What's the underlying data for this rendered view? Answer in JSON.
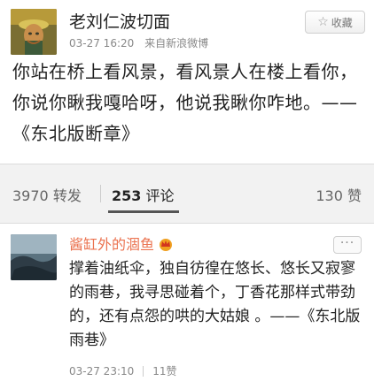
{
  "post": {
    "username": "老刘仁波切面",
    "time": "03-27 16:20",
    "source": "来自新浪微博",
    "favorite_label": "收藏",
    "text": "你站在桥上看风景，看风景人在楼上看你，你说你瞅我嘎哈呀，他说我瞅你咋地。——《东北版断章》"
  },
  "stats": {
    "reposts_count": "3970",
    "reposts_label": "转发",
    "comments_count": "253",
    "comments_label": "评论",
    "likes_count": "130",
    "likes_label": "赞"
  },
  "comment": {
    "username": "酱缸外的涸鱼",
    "more_label": "···",
    "text": "撑着油纸伞，独自彷徨在悠长、悠长又寂寥的雨巷，我寻思碰着个，丁香花那样式带劲的，还有点怨的哄的大姑娘 。——《东北版雨巷》",
    "time": "03-27 23:10",
    "likes": "11赞"
  },
  "colors": {
    "accent_name": "#eb7350",
    "crown": "#f0a020"
  }
}
